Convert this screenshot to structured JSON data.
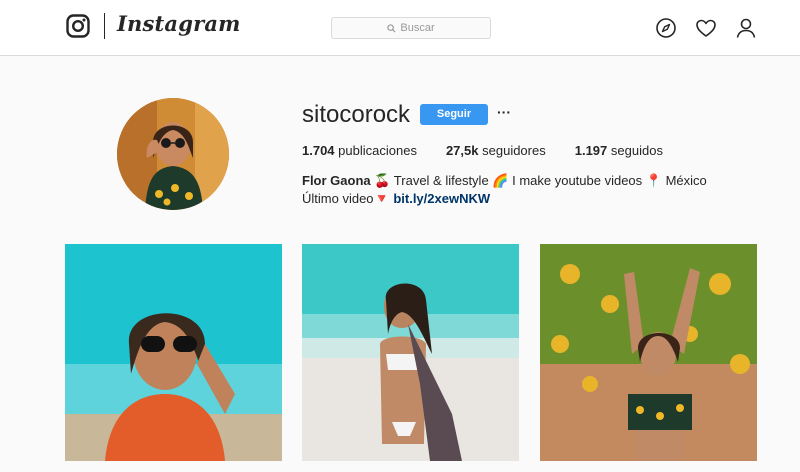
{
  "header": {
    "brand": "Instagram",
    "search_placeholder": "Buscar",
    "icons": [
      "instagram-camera-icon",
      "compass-icon",
      "heart-icon",
      "person-icon"
    ]
  },
  "profile": {
    "username": "sitocorock",
    "follow_label": "Seguir",
    "more_label": "···",
    "stats": {
      "posts_count": "1.704",
      "posts_label": "publicaciones",
      "followers_count": "27,5k",
      "followers_label": "seguidores",
      "following_count": "1.197",
      "following_label": "seguidos"
    },
    "bio": {
      "name": "Flor Gaona",
      "text_1": " 🍒 Travel & lifestyle 🌈 I make youtube videos 📍 México Último video🔻 ",
      "link": "bit.ly/2xewNKW"
    }
  },
  "posts": [
    {
      "name": "post-1",
      "palette": [
        "#1ec3d0",
        "#e35d2a"
      ]
    },
    {
      "name": "post-2",
      "palette": [
        "#3cc8c7",
        "#ffffff"
      ]
    },
    {
      "name": "post-3",
      "palette": [
        "#e8b42a",
        "#6b8f2a"
      ]
    }
  ],
  "colors": {
    "accent": "#3897f0",
    "link": "#003569",
    "background": "#fafafa",
    "border": "#dbdbdb"
  }
}
